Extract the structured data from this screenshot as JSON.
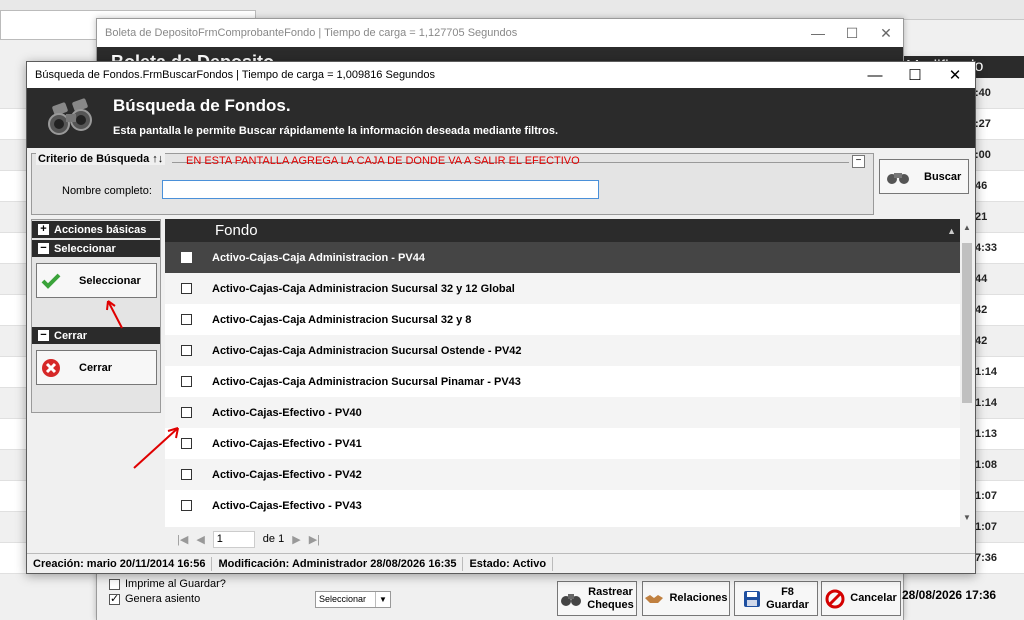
{
  "background": {
    "header_label": "Modificado",
    "times": [
      ":40",
      ":27",
      ":00",
      "46",
      "21",
      "4:33",
      "44",
      "42",
      "42",
      "1:14",
      "1:14",
      "1:13",
      "1:08",
      "1:07",
      "1:07",
      "7:36"
    ]
  },
  "back_window": {
    "title": "Boleta de DepositoFrmComprobanteFondo | Tiempo de carga = 1,127705 Segundos",
    "banner": "Boleta de Deposito",
    "checkbox_print": "Imprime al Guardar?",
    "checkbox_seat": "Genera asiento",
    "select_value": "Seleccionar",
    "btn_track": "Rastrear\nCheques",
    "btn_relations": "Relaciones",
    "btn_save": "F8\nGuardar",
    "btn_cancel": "Cancelar",
    "date": "28/08/2026 17:36"
  },
  "window": {
    "title": "Búsqueda de Fondos.FrmBuscarFondos | Tiempo de carga = 1,009816 Segundos",
    "minimize": "—",
    "maximize": "☐",
    "close": "✕"
  },
  "banner": {
    "title": "Búsqueda de Fondos.",
    "subtitle": "Esta pantalla le permite Buscar rápidamente la información deseada mediante filtros."
  },
  "criteria": {
    "legend": "Criterio de Búsqueda ↑↓",
    "note": "EN ESTA PANTALLA AGREGA LA CAJA DE DONDE VA A SALIR EL EFECTIVO",
    "label": "Nombre completo:",
    "value": ""
  },
  "search_button": "Buscar",
  "left_panel": {
    "basic_actions": "Acciones básicas",
    "select_section": "Seleccionar",
    "select_button": "Seleccionar",
    "close_section": "Cerrar",
    "close_button": "Cerrar"
  },
  "grid": {
    "column": "Fondo",
    "rows": [
      "Activo-Cajas-Caja Administracion - PV44",
      "Activo-Cajas-Caja Administracion Sucursal 32 y 12 Global",
      "Activo-Cajas-Caja Administracion Sucursal 32 y 8",
      "Activo-Cajas-Caja Administracion Sucursal Ostende - PV42",
      "Activo-Cajas-Caja Administracion Sucursal Pinamar - PV43",
      "Activo-Cajas-Efectivo - PV40",
      "Activo-Cajas-Efectivo - PV41",
      "Activo-Cajas-Efectivo - PV42",
      "Activo-Cajas-Efectivo - PV43"
    ]
  },
  "pager": {
    "page": "1",
    "of": "de 1"
  },
  "status": {
    "created": "Creación: mario 20/11/2014 16:56",
    "modified": "Modificación: Administrador 28/08/2026 16:35",
    "state": "Estado: Activo"
  },
  "colors": {
    "dark": "#2b2b2b",
    "selected_row": "#454545",
    "annotation_red": "#e00000"
  }
}
